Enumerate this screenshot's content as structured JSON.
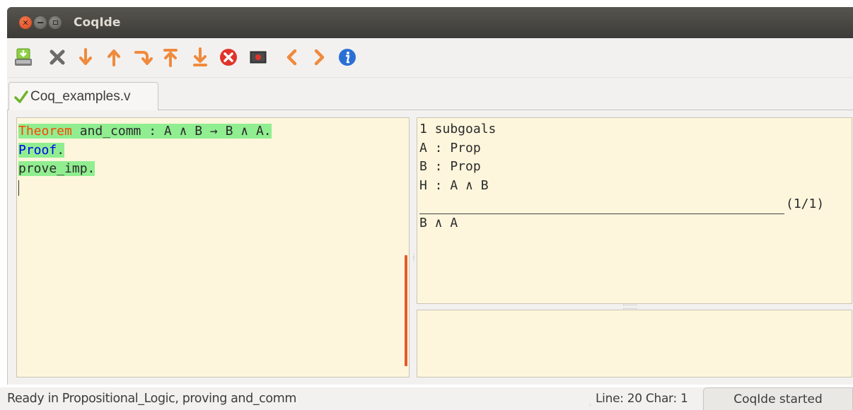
{
  "window": {
    "title": "CoqIde",
    "controls": {
      "close": "close-icon",
      "minimize": "minimize-icon",
      "maximize": "maximize-icon"
    }
  },
  "toolbar": {
    "buttons": [
      {
        "icon": "save-icon",
        "color": "#6fb32c"
      },
      {
        "icon": "close-x-icon",
        "color": "#6b6b6b"
      },
      {
        "icon": "arrow-down-icon",
        "color": "#f08a3c"
      },
      {
        "icon": "arrow-up-icon",
        "color": "#f08a3c"
      },
      {
        "icon": "go-to-cursor-icon",
        "color": "#f08a3c"
      },
      {
        "icon": "go-to-start-icon",
        "color": "#f08a3c"
      },
      {
        "icon": "go-to-end-icon",
        "color": "#f08a3c"
      },
      {
        "icon": "interrupt-icon",
        "color": "#e0342a"
      },
      {
        "icon": "reset-icon",
        "color": "#3c3c3c"
      },
      {
        "icon": "previous-icon",
        "color": "#f08a3c"
      },
      {
        "icon": "next-icon",
        "color": "#f08a3c"
      },
      {
        "icon": "about-info-icon",
        "color": "#2a6fd6"
      }
    ]
  },
  "tabs": [
    {
      "label": "Coq_examples.v",
      "status_icon": "checkmark-icon"
    }
  ],
  "editor": {
    "lines": [
      {
        "keyword": "Theorem",
        "rest": " and_comm : A ∧ B → B ∧ A."
      },
      {
        "keyword": "Proof",
        "rest": "."
      },
      {
        "text": "prove_imp."
      }
    ],
    "colors": {
      "processed_bg": "#90ee90",
      "theorem_kw": "#ff4500",
      "proof_kw": "#0000ee",
      "pane_bg": "#fdf6dc"
    }
  },
  "goals": {
    "header": "1 subgoals",
    "hypotheses": [
      "A : Prop",
      "B : Prop",
      "H : A ∧ B"
    ],
    "counter": "(1/1)",
    "conclusion": "B ∧ A"
  },
  "messages": {
    "text": ""
  },
  "status": {
    "message": "Ready in Propositional_Logic, proving and_comm",
    "position": "Line:  20 Char:  1",
    "coqide_state": "CoqIde started"
  }
}
